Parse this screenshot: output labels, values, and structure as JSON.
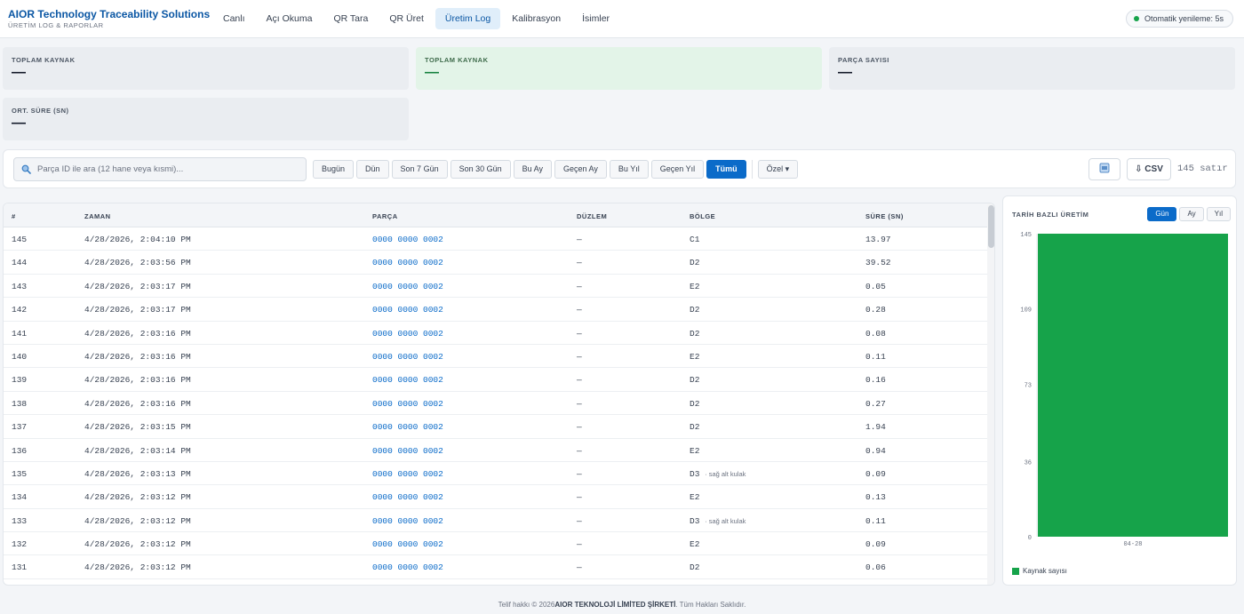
{
  "brand": {
    "title": "AIOR Technology Traceability Solutions",
    "subtitle": "ÜRETİM LOG & RAPORLAR"
  },
  "nav": [
    "Canlı",
    "Açı Okuma",
    "QR Tara",
    "QR Üret",
    "Üretim Log",
    "Kalibrasyon",
    "İsimler"
  ],
  "nav_active": "Üretim Log",
  "auto_refresh": "Otomatik yenileme: 5s",
  "cards": [
    {
      "label": "TOPLAM KAYNAK",
      "value": "—"
    },
    {
      "label": "TOPLAM KAYNAK",
      "value": "—"
    },
    {
      "label": "PARÇA SAYISI",
      "value": "—"
    },
    {
      "label": "ORT. SÜRE (SN)",
      "value": "—"
    }
  ],
  "filter": {
    "search_placeholder": "Parça ID ile ara (12 hane veya kısmi)...",
    "ranges": [
      "Bugün",
      "Dün",
      "Son 7 Gün",
      "Son 30 Gün",
      "Bu Ay",
      "Geçen Ay",
      "Bu Yıl",
      "Geçen Yıl",
      "Tümü"
    ],
    "active_range": "Tümü",
    "custom": "Özel ▾",
    "csv": "⇩ CSV",
    "row_count": "145 satır"
  },
  "table": {
    "headers": [
      "#",
      "ZAMAN",
      "PARÇA",
      "DÜZLEM",
      "BÖLGE",
      "SÜRE (SN)"
    ],
    "rows": [
      {
        "id": "145",
        "time": "4/28/2026, 2:04:10 PM",
        "part": "0000 0000 0002",
        "plane": "—",
        "region": "C1",
        "note": "",
        "dur": "13.97"
      },
      {
        "id": "144",
        "time": "4/28/2026, 2:03:56 PM",
        "part": "0000 0000 0002",
        "plane": "—",
        "region": "D2",
        "note": "",
        "dur": "39.52"
      },
      {
        "id": "143",
        "time": "4/28/2026, 2:03:17 PM",
        "part": "0000 0000 0002",
        "plane": "—",
        "region": "E2",
        "note": "",
        "dur": "0.05"
      },
      {
        "id": "142",
        "time": "4/28/2026, 2:03:17 PM",
        "part": "0000 0000 0002",
        "plane": "—",
        "region": "D2",
        "note": "",
        "dur": "0.28"
      },
      {
        "id": "141",
        "time": "4/28/2026, 2:03:16 PM",
        "part": "0000 0000 0002",
        "plane": "—",
        "region": "D2",
        "note": "",
        "dur": "0.08"
      },
      {
        "id": "140",
        "time": "4/28/2026, 2:03:16 PM",
        "part": "0000 0000 0002",
        "plane": "—",
        "region": "E2",
        "note": "",
        "dur": "0.11"
      },
      {
        "id": "139",
        "time": "4/28/2026, 2:03:16 PM",
        "part": "0000 0000 0002",
        "plane": "—",
        "region": "D2",
        "note": "",
        "dur": "0.16"
      },
      {
        "id": "138",
        "time": "4/28/2026, 2:03:16 PM",
        "part": "0000 0000 0002",
        "plane": "—",
        "region": "D2",
        "note": "",
        "dur": "0.27"
      },
      {
        "id": "137",
        "time": "4/28/2026, 2:03:15 PM",
        "part": "0000 0000 0002",
        "plane": "—",
        "region": "D2",
        "note": "",
        "dur": "1.94"
      },
      {
        "id": "136",
        "time": "4/28/2026, 2:03:14 PM",
        "part": "0000 0000 0002",
        "plane": "—",
        "region": "E2",
        "note": "",
        "dur": "0.94"
      },
      {
        "id": "135",
        "time": "4/28/2026, 2:03:13 PM",
        "part": "0000 0000 0002",
        "plane": "—",
        "region": "D3",
        "note": "· sağ alt kulak",
        "dur": "0.09"
      },
      {
        "id": "134",
        "time": "4/28/2026, 2:03:12 PM",
        "part": "0000 0000 0002",
        "plane": "—",
        "region": "E2",
        "note": "",
        "dur": "0.13"
      },
      {
        "id": "133",
        "time": "4/28/2026, 2:03:12 PM",
        "part": "0000 0000 0002",
        "plane": "—",
        "region": "D3",
        "note": "· sağ alt kulak",
        "dur": "0.11"
      },
      {
        "id": "132",
        "time": "4/28/2026, 2:03:12 PM",
        "part": "0000 0000 0002",
        "plane": "—",
        "region": "E2",
        "note": "",
        "dur": "0.09"
      },
      {
        "id": "131",
        "time": "4/28/2026, 2:03:12 PM",
        "part": "0000 0000 0002",
        "plane": "—",
        "region": "D2",
        "note": "",
        "dur": "0.06"
      }
    ]
  },
  "chart_panel": {
    "title": "TARİH BAZLI ÜRETİM",
    "granularity": [
      "Gün",
      "Ay",
      "Yıl"
    ],
    "active_granularity": "Gün"
  },
  "chart_data": {
    "type": "bar",
    "categories": [
      "04-28"
    ],
    "series": [
      {
        "name": "Kaynak sayısı",
        "values": [
          145
        ],
        "color": "#16a34a"
      }
    ],
    "yticks": [
      0,
      36,
      73,
      109,
      145
    ],
    "ylim": [
      0,
      145
    ],
    "legend": "bottom-left",
    "grid": false
  },
  "footer": {
    "prefix": "Telif hakkı © 2026",
    "company": "AIOR TEKNOLOJİ LİMİTED ŞİRKETİ",
    "suffix": ". Tüm Hakları Saklıdır."
  },
  "colors": {
    "brand": "#0b57a4",
    "accent": "#0b6bc9",
    "success": "#16a34a"
  }
}
